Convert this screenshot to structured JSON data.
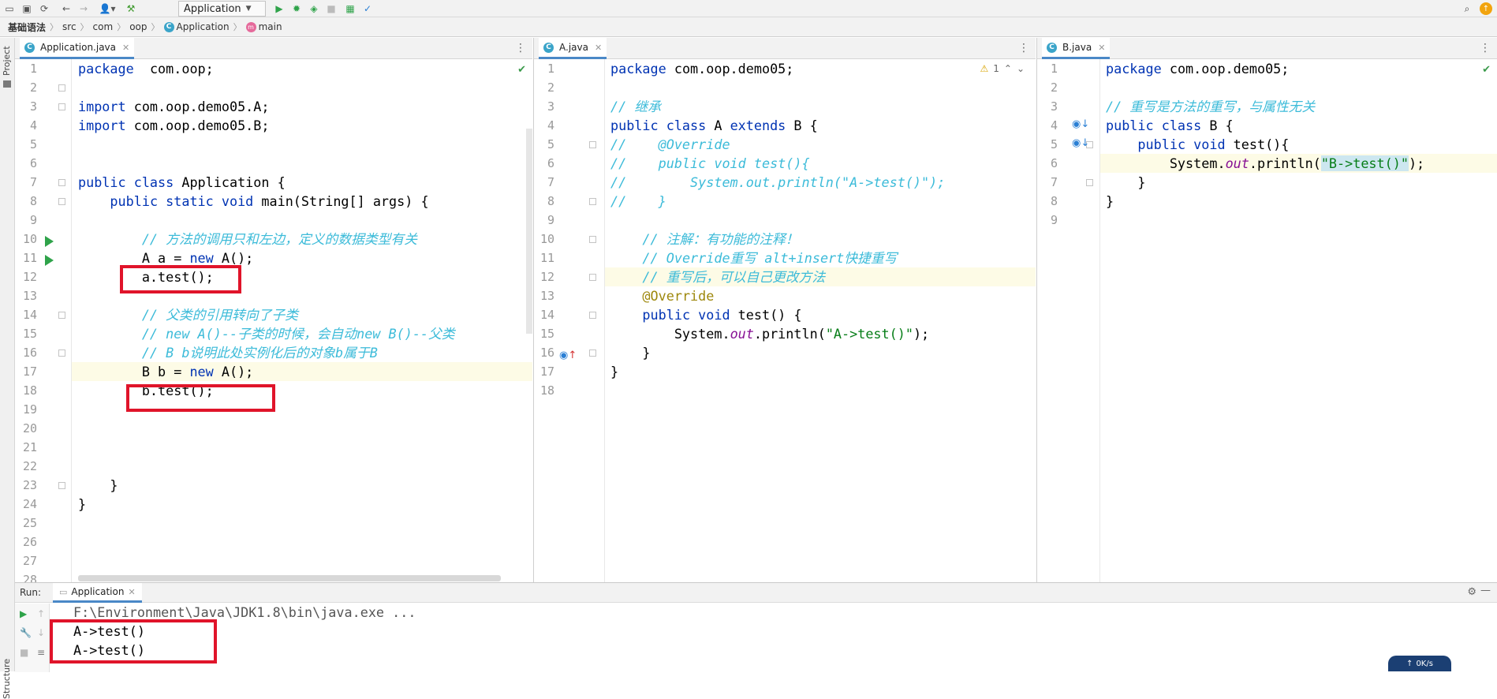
{
  "toolbar": {
    "run_config": "Application",
    "icons": [
      "open-icon",
      "save-icon",
      "sync-icon",
      "back-icon",
      "forward-icon",
      "user-icon",
      "build-icon",
      "run-icon",
      "debug-icon",
      "coverage-icon",
      "stop-icon",
      "profiler-icon",
      "update-icon",
      "search-icon",
      "updates-badge-icon"
    ]
  },
  "breadcrumb": [
    "基础语法",
    "src",
    "com",
    "oop",
    "Application",
    "main"
  ],
  "left_strip": {
    "project_label": "Project",
    "structure_label": "Structure"
  },
  "panes": [
    {
      "tab": "Application.java",
      "line_numbers": [
        "1",
        "2",
        "3",
        "4",
        "5",
        "6",
        "7",
        "8",
        "9",
        "10",
        "11",
        "12",
        "13",
        "14",
        "15",
        "16",
        "17",
        "18",
        "19",
        "20",
        "21",
        "22",
        "23",
        "24",
        "25",
        "26",
        "27",
        "28"
      ],
      "lines": [
        [
          [
            "kw",
            "package"
          ],
          [
            "",
            "  com.oop;"
          ]
        ],
        [],
        [
          [
            "kw",
            "import"
          ],
          [
            "",
            " com.oop.demo05.A;"
          ]
        ],
        [
          [
            "kw",
            "import"
          ],
          [
            "",
            " com.oop.demo05.B;"
          ]
        ],
        [],
        [],
        [
          [
            "kw",
            "public class"
          ],
          [
            "",
            " Application {"
          ]
        ],
        [
          [
            "",
            "    "
          ],
          [
            "kw",
            "public static void"
          ],
          [
            "",
            " main(String[] args) {"
          ]
        ],
        [],
        [
          [
            "",
            "        "
          ],
          [
            "cm",
            "// 方法的调用只和左边，定义的数据类型有关"
          ]
        ],
        [
          [
            "",
            "        A a = "
          ],
          [
            "kw",
            "new"
          ],
          [
            "",
            " A();"
          ]
        ],
        [
          [
            "",
            "        a.test();"
          ]
        ],
        [],
        [
          [
            "",
            "        "
          ],
          [
            "cm",
            "// 父类的引用转向了子类"
          ]
        ],
        [
          [
            "",
            "        "
          ],
          [
            "cm",
            "// new A()--子类的时候，会自动new B()--父类"
          ]
        ],
        [
          [
            "",
            "        "
          ],
          [
            "cm",
            "// B b说明此处实例化后的对象b属于B"
          ]
        ],
        [
          [
            "",
            "        B b = "
          ],
          [
            "kw",
            "new"
          ],
          [
            "",
            " A();"
          ]
        ],
        [
          [
            "",
            "        b.test();"
          ]
        ],
        [],
        [],
        [],
        [],
        [
          [
            "",
            "    }"
          ]
        ],
        [
          [
            "",
            "}"
          ]
        ],
        [],
        [],
        [],
        []
      ]
    },
    {
      "tab": "A.java",
      "warning_count": "1",
      "line_numbers": [
        "1",
        "2",
        "3",
        "4",
        "5",
        "6",
        "7",
        "8",
        "9",
        "10",
        "11",
        "12",
        "13",
        "14",
        "15",
        "16",
        "17",
        "18"
      ],
      "lines": [
        [
          [
            "kw",
            "package"
          ],
          [
            "",
            " com.oop.demo05;"
          ]
        ],
        [],
        [
          [
            "cm",
            "// 继承"
          ]
        ],
        [
          [
            "kw",
            "public class"
          ],
          [
            "",
            " A "
          ],
          [
            "kw",
            "extends"
          ],
          [
            "",
            " B {"
          ]
        ],
        [
          [
            "cm",
            "//    @Override"
          ]
        ],
        [
          [
            "cm",
            "//    public void test(){"
          ]
        ],
        [
          [
            "cm",
            "//        System.out.println(\"A->test()\");"
          ]
        ],
        [
          [
            "cm",
            "//    }"
          ]
        ],
        [],
        [
          [
            "",
            "    "
          ],
          [
            "cm",
            "// 注解：有功能的注释！"
          ]
        ],
        [
          [
            "",
            "    "
          ],
          [
            "cm",
            "// Override重写 alt+insert快捷重写"
          ]
        ],
        [
          [
            "",
            "    "
          ],
          [
            "cm",
            "// 重写后，可以自己更改方法"
          ]
        ],
        [
          [
            "",
            "    "
          ],
          [
            "ann",
            "@Override"
          ]
        ],
        [
          [
            "",
            "    "
          ],
          [
            "kw",
            "public void"
          ],
          [
            "",
            " test() {"
          ]
        ],
        [
          [
            "",
            "        System."
          ],
          [
            "fld",
            "out"
          ],
          [
            "",
            ".println("
          ],
          [
            "str",
            "\"A->test()\""
          ],
          [
            "",
            ");"
          ]
        ],
        [
          [
            "",
            "    }"
          ]
        ],
        [
          [
            "",
            "}"
          ]
        ],
        []
      ]
    },
    {
      "tab": "B.java",
      "line_numbers": [
        "1",
        "2",
        "3",
        "4",
        "5",
        "6",
        "7",
        "8",
        "9"
      ],
      "lines": [
        [
          [
            "kw",
            "package"
          ],
          [
            "",
            " com.oop.demo05;"
          ]
        ],
        [],
        [
          [
            "cm",
            "// 重写是方法的重写，与属性无关"
          ]
        ],
        [
          [
            "kw",
            "public class"
          ],
          [
            "",
            " B {"
          ]
        ],
        [
          [
            "",
            "    "
          ],
          [
            "kw",
            "public void"
          ],
          [
            "",
            " test(){"
          ]
        ],
        [
          [
            "",
            "        System."
          ],
          [
            "fld",
            "out"
          ],
          [
            "",
            ".println("
          ],
          [
            "strhl",
            "\"B->test()\""
          ],
          [
            "",
            ");"
          ]
        ],
        [
          [
            "",
            "    }"
          ]
        ],
        [
          [
            "",
            "}"
          ]
        ],
        []
      ]
    }
  ],
  "run_panel": {
    "label": "Run:",
    "tab": "Application",
    "command": "F:\\Environment\\Java\\JDK1.8\\bin\\java.exe ...",
    "output": [
      "A->test()",
      "A->test()"
    ]
  },
  "status": {
    "net": "0K/s"
  }
}
